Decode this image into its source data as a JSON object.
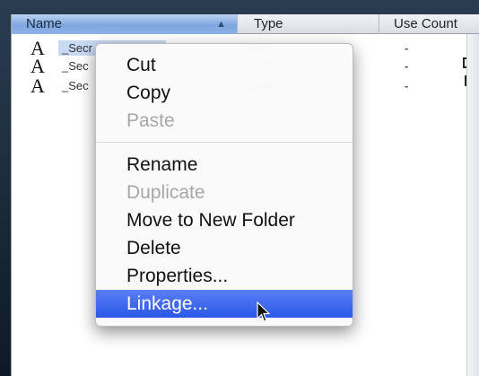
{
  "header": {
    "name_label": "Name",
    "sort_indicator": "▲",
    "type_label": "Type",
    "use_count_label": "Use Count"
  },
  "rows": [
    {
      "icon": "font-symbol-icon",
      "glyph": "A",
      "name": "_Secr",
      "type": "Font",
      "use_count": "-"
    },
    {
      "icon": "font-symbol-icon",
      "glyph": "A",
      "name": "_Sec",
      "type": "Font",
      "use_count": "-"
    },
    {
      "icon": "font-symbol-icon",
      "glyph": "A",
      "name": "_Sec",
      "type": "Font",
      "use_count": "-"
    }
  ],
  "context_menu": {
    "items": [
      {
        "label": "Cut",
        "enabled": true
      },
      {
        "label": "Copy",
        "enabled": true
      },
      {
        "label": "Paste",
        "enabled": false
      },
      {
        "label": "Rename",
        "enabled": true
      },
      {
        "label": "Duplicate",
        "enabled": false
      },
      {
        "label": "Move to New Folder",
        "enabled": true
      },
      {
        "label": "Delete",
        "enabled": true
      },
      {
        "label": "Properties...",
        "enabled": true
      },
      {
        "label": "Linkage...",
        "enabled": true,
        "highlighted": true
      }
    ]
  },
  "colors": {
    "highlight": "#2a57e8",
    "selected_header": "#7fa6de",
    "disabled_text": "#a7a7a7"
  }
}
